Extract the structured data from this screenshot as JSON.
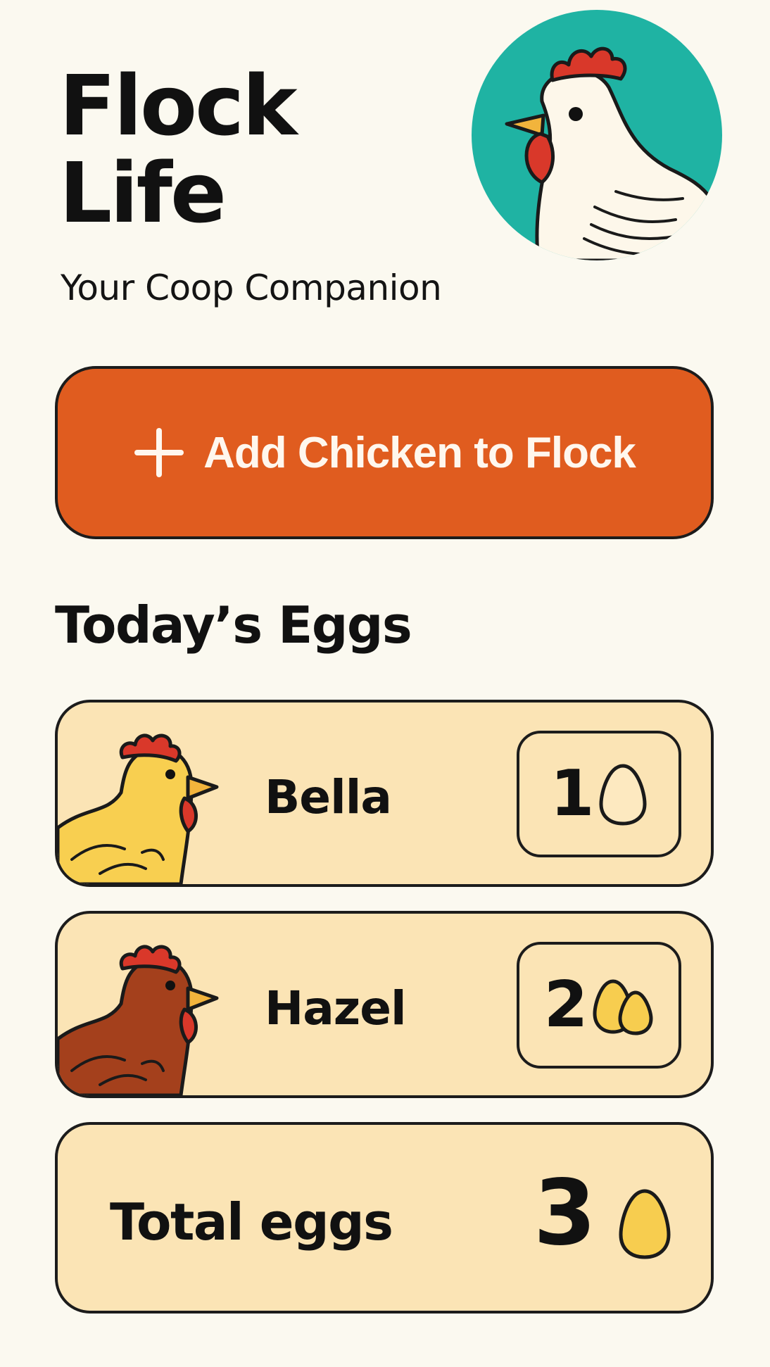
{
  "app": {
    "title_line1": "Flock",
    "title_line2": "Life",
    "subtitle": "Your Coop Companion",
    "hero_icon": "rooster-avatar-icon"
  },
  "actions": {
    "add_chicken_label": "Add Chicken to Flock",
    "add_icon": "plus-icon"
  },
  "eggs": {
    "heading": "Today’s Eggs",
    "chickens": [
      {
        "name": "Bella",
        "count": "1",
        "icon": "yellow-hen-icon",
        "egg_icon": "outlined-egg-icon"
      },
      {
        "name": "Hazel",
        "count": "2",
        "icon": "brown-hen-icon",
        "egg_icon": "two-eggs-icon"
      }
    ],
    "total_label": "Total eggs",
    "total_count": "3",
    "total_icon": "yellow-egg-icon"
  },
  "colors": {
    "background": "#fbf9f0",
    "accent": "#e05c1f",
    "card": "#fbe4b5",
    "teal": "#1fb3a3",
    "egg_yellow": "#f7cd4f",
    "comb_red": "#d9382a",
    "hen_yellow": "#f8cf50",
    "hen_brown": "#a4401c"
  }
}
